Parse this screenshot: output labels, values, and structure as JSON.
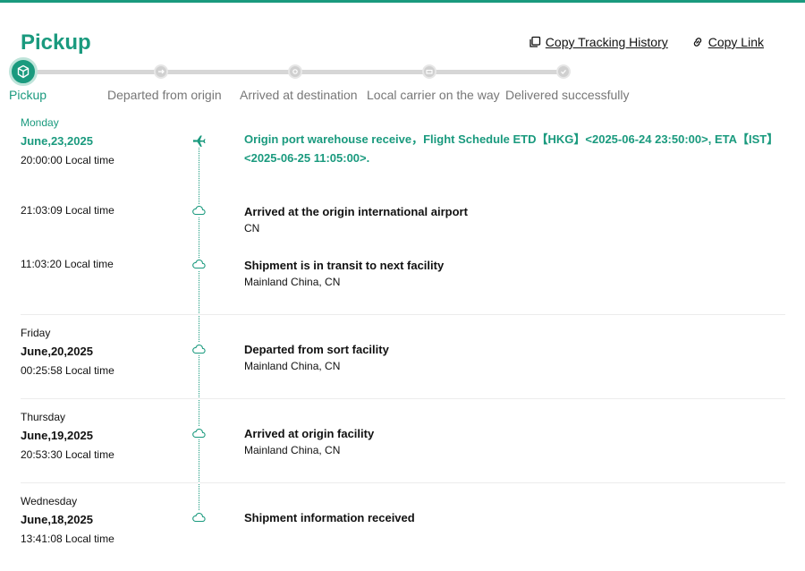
{
  "status": {
    "title": "Pickup"
  },
  "actions": {
    "copy_history": "Copy Tracking History",
    "copy_link": "Copy Link"
  },
  "progress": {
    "steps": [
      {
        "label": "Pickup"
      },
      {
        "label": "Departed from origin"
      },
      {
        "label": "Arrived at destination"
      },
      {
        "label": "Local carrier on the way"
      },
      {
        "label": "Delivered successfully"
      }
    ],
    "current_step": 1
  },
  "colors": {
    "accent": "#1a9a7e",
    "inactive": "#d0d0d0"
  },
  "groups": [
    {
      "weekday": "Monday",
      "date": "June,23,2025"
    },
    {
      "weekday": "Friday",
      "date": "June,20,2025"
    },
    {
      "weekday": "Thursday",
      "date": "June,19,2025"
    },
    {
      "weekday": "Wednesday",
      "date": "June,18,2025"
    }
  ],
  "events": [
    {
      "time": "20:00:00 Local time",
      "title": "Origin port warehouse receive，Flight Schedule ETD【HKG】<2025-06-24 23:50:00>, ETA【IST】<2025-06-25 11:05:00>.",
      "location": "",
      "icon": "plane-icon"
    },
    {
      "time": "21:03:09 Local time",
      "title": "Arrived at the origin international airport",
      "location": "CN",
      "icon": "cloud-icon"
    },
    {
      "time": "11:03:20 Local time",
      "title": "Shipment is in transit to next facility",
      "location": "Mainland China, CN",
      "icon": "cloud-icon"
    },
    {
      "time": "00:25:58 Local time",
      "title": "Departed from sort facility",
      "location": "Mainland China, CN",
      "icon": "cloud-icon"
    },
    {
      "time": "20:53:30 Local time",
      "title": "Arrived at origin facility",
      "location": "Mainland China, CN",
      "icon": "cloud-icon"
    },
    {
      "time": "13:41:08 Local time",
      "title": "Shipment information received",
      "location": "",
      "icon": "cloud-icon"
    }
  ]
}
